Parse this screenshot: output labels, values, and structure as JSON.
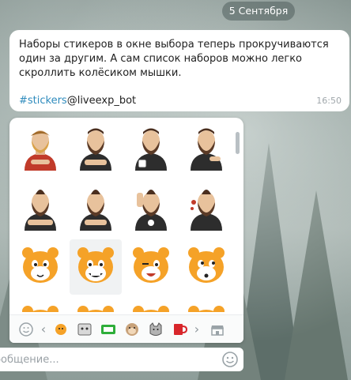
{
  "date_label": "5 Сентября",
  "message": {
    "text": "Наборы стикеров в окне выбора теперь прокручиваются один за другим. А сам список наборов можно легко скроллить колёсиком мышки.",
    "hashtag": "#stickers",
    "mention": "@liveexp_bot",
    "time": "16:50"
  },
  "sticker_panel": {
    "rows": [
      [
        "bearded-man-sticker",
        "bearded-man-sticker",
        "bearded-man-sticker",
        "bearded-man-sticker"
      ],
      [
        "bearded-man-sticker",
        "bearded-man-sticker",
        "bearded-man-sticker",
        "bearded-man-sticker"
      ],
      [
        "tiger-sticker",
        "tiger-sticker",
        "tiger-sticker",
        "tiger-sticker"
      ]
    ],
    "tabs": [
      "recent-smile-icon",
      "sticker-set-tiger",
      "sticker-set-gray",
      "sticker-set-green-logo",
      "sticker-set-monkey",
      "sticker-set-cat",
      "sticker-set-red-cup",
      "store-icon"
    ]
  },
  "input": {
    "placeholder": "Сообщение..."
  },
  "colors": {
    "accent": "#2e8bbd",
    "tiger_orange": "#f5a228",
    "beard": "#5a3a26"
  }
}
